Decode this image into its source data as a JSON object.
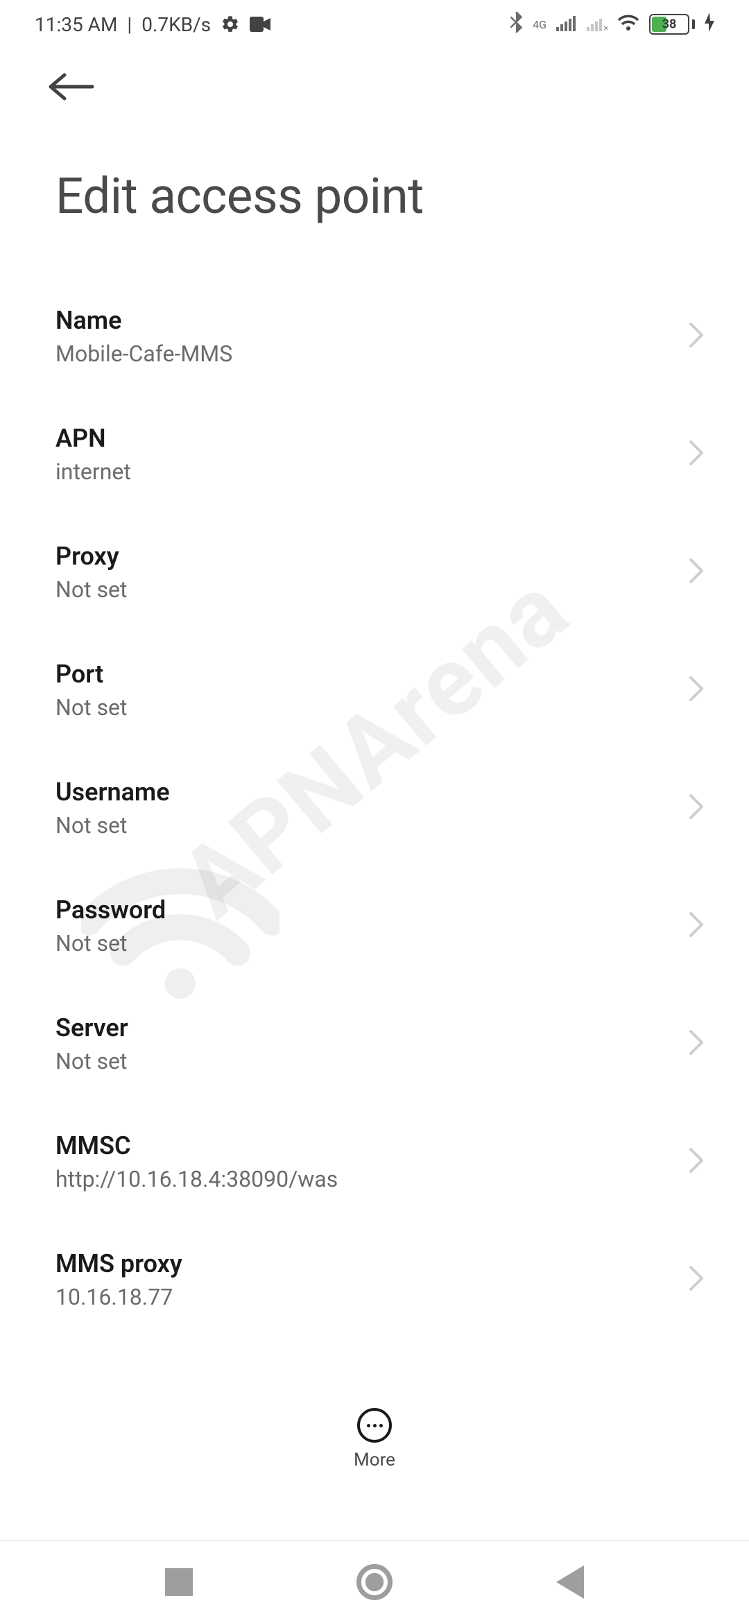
{
  "status": {
    "time": "11:35 AM",
    "data_rate": "0.7KB/s",
    "network_tag": "4G",
    "battery_percent": "38"
  },
  "page_title": "Edit access point",
  "fields": [
    {
      "label": "Name",
      "value": "Mobile-Cafe-MMS"
    },
    {
      "label": "APN",
      "value": "internet"
    },
    {
      "label": "Proxy",
      "value": "Not set"
    },
    {
      "label": "Port",
      "value": "Not set"
    },
    {
      "label": "Username",
      "value": "Not set"
    },
    {
      "label": "Password",
      "value": "Not set"
    },
    {
      "label": "Server",
      "value": "Not set"
    },
    {
      "label": "MMSC",
      "value": "http://10.16.18.4:38090/was"
    },
    {
      "label": "MMS proxy",
      "value": "10.16.18.77"
    }
  ],
  "more_label": "More",
  "watermark_text": "APNArena"
}
